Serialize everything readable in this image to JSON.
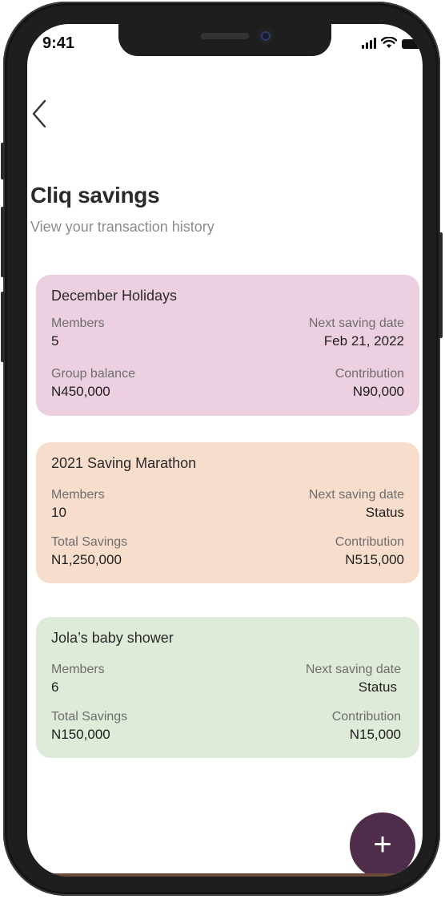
{
  "status_bar": {
    "time": "9:41"
  },
  "header": {
    "back_icon": "chevron-left-icon",
    "title": "Cliq savings",
    "subtitle": "View your transaction history"
  },
  "cards": [
    {
      "name": "December Holidays",
      "color": "#ecd0e2",
      "members_label": "Members",
      "members": "5",
      "date_label": "Next saving date",
      "date_value": "Feb 21, 2022",
      "balance_label": "Group balance",
      "balance": "N450,000",
      "contribution_label": "Contribution",
      "contribution": "N90,000"
    },
    {
      "name": "2021 Saving Marathon",
      "color": "#f7ddcb",
      "members_label": "Members",
      "members": "10",
      "date_label": "Next saving date",
      "date_value": "Status",
      "balance_label": "Total Savings",
      "balance": "N1,250,000",
      "contribution_label": "Contribution",
      "contribution": "N515,000"
    },
    {
      "name": "Jola’s baby shower",
      "color": "#deebd9",
      "members_label": "Members",
      "members": "6",
      "date_label": "Next saving date",
      "date_value": "Status",
      "balance_label": "Total Savings",
      "balance": "N150,000",
      "contribution_label": "Contribution",
      "contribution": "N15,000"
    }
  ],
  "fab": {
    "icon": "plus-icon",
    "label": "+",
    "color": "#4f2d4a"
  }
}
